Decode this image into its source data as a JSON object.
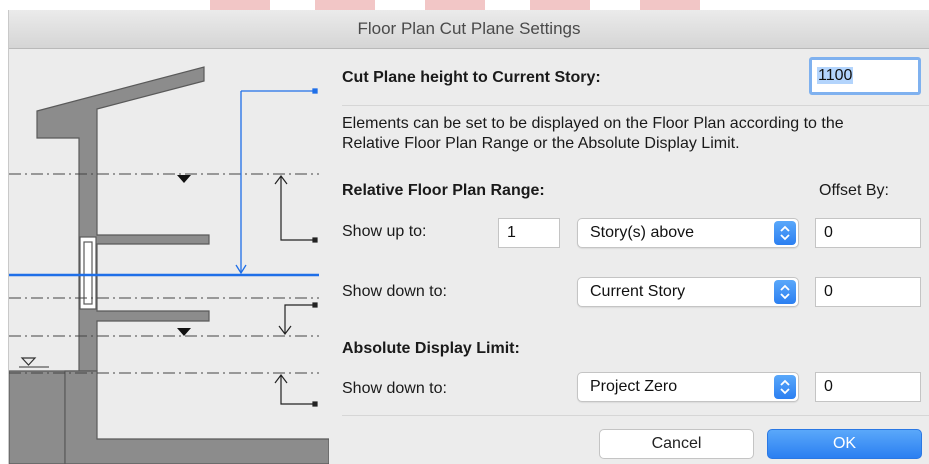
{
  "dialog": {
    "title": "Floor Plan Cut Plane Settings"
  },
  "cut_plane": {
    "label": "Cut Plane height to Current Story:",
    "value": "1100"
  },
  "description": {
    "line1": "Elements can be set to be displayed on the Floor Plan according to the",
    "line2": "Relative Floor Plan Range or the Absolute Display Limit."
  },
  "relative": {
    "heading": "Relative Floor Plan Range:",
    "offset_heading": "Offset By:",
    "show_up": {
      "label": "Show up to:",
      "count": "1",
      "select": "Story(s) above",
      "offset": "0"
    },
    "show_down": {
      "label": "Show down to:",
      "select": "Current Story",
      "offset": "0"
    }
  },
  "absolute": {
    "heading": "Absolute Display Limit:",
    "show_down": {
      "label": "Show down to:",
      "select": "Project Zero",
      "offset": "0"
    }
  },
  "buttons": {
    "cancel": "Cancel",
    "ok": "OK"
  },
  "colors": {
    "accent": "#2b7ff1",
    "cut_line": "#1f6fe8"
  }
}
